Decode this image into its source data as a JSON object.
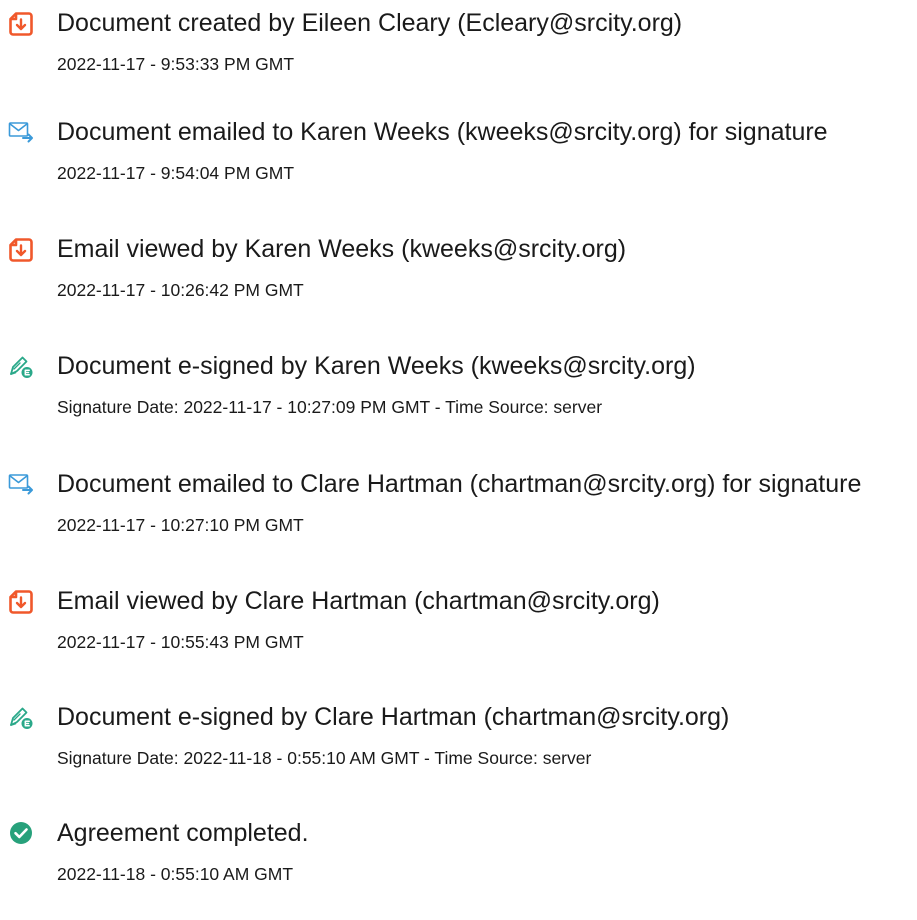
{
  "audit_history": {
    "events": [
      {
        "icon": "document-created-icon",
        "title": "Document created by Eileen Cleary (Ecleary@srcity.org)",
        "detail": "2022-11-17 - 9:53:33 PM GMT"
      },
      {
        "icon": "email-sent-icon",
        "title": "Document emailed to Karen Weeks (kweeks@srcity.org) for signature",
        "detail": "2022-11-17 - 9:54:04 PM GMT"
      },
      {
        "icon": "email-viewed-icon",
        "title": "Email viewed by Karen Weeks (kweeks@srcity.org)",
        "detail": "2022-11-17 - 10:26:42 PM GMT"
      },
      {
        "icon": "e-sign-icon",
        "title": "Document e-signed by Karen Weeks (kweeks@srcity.org)",
        "detail": "Signature Date: 2022-11-17 - 10:27:09 PM GMT - Time Source: server"
      },
      {
        "icon": "email-sent-icon",
        "title": "Document emailed to Clare Hartman (chartman@srcity.org) for signature",
        "detail": "2022-11-17 - 10:27:10 PM GMT"
      },
      {
        "icon": "email-viewed-icon",
        "title": "Email viewed by Clare Hartman (chartman@srcity.org)",
        "detail": "2022-11-17 - 10:55:43 PM GMT"
      },
      {
        "icon": "e-sign-icon",
        "title": "Document e-signed by Clare Hartman (chartman@srcity.org)",
        "detail": "Signature Date: 2022-11-18 - 0:55:10 AM GMT - Time Source: server"
      },
      {
        "icon": "agreement-completed-icon",
        "title": "Agreement completed.",
        "detail": "2022-11-18 - 0:55:10 AM GMT"
      }
    ]
  },
  "colors": {
    "document_icon": "#f0582b",
    "email_icon": "#3b9ad9",
    "esign_icon": "#2aa889",
    "completed_icon": "#27a17b",
    "text": "#1a1a1a"
  }
}
